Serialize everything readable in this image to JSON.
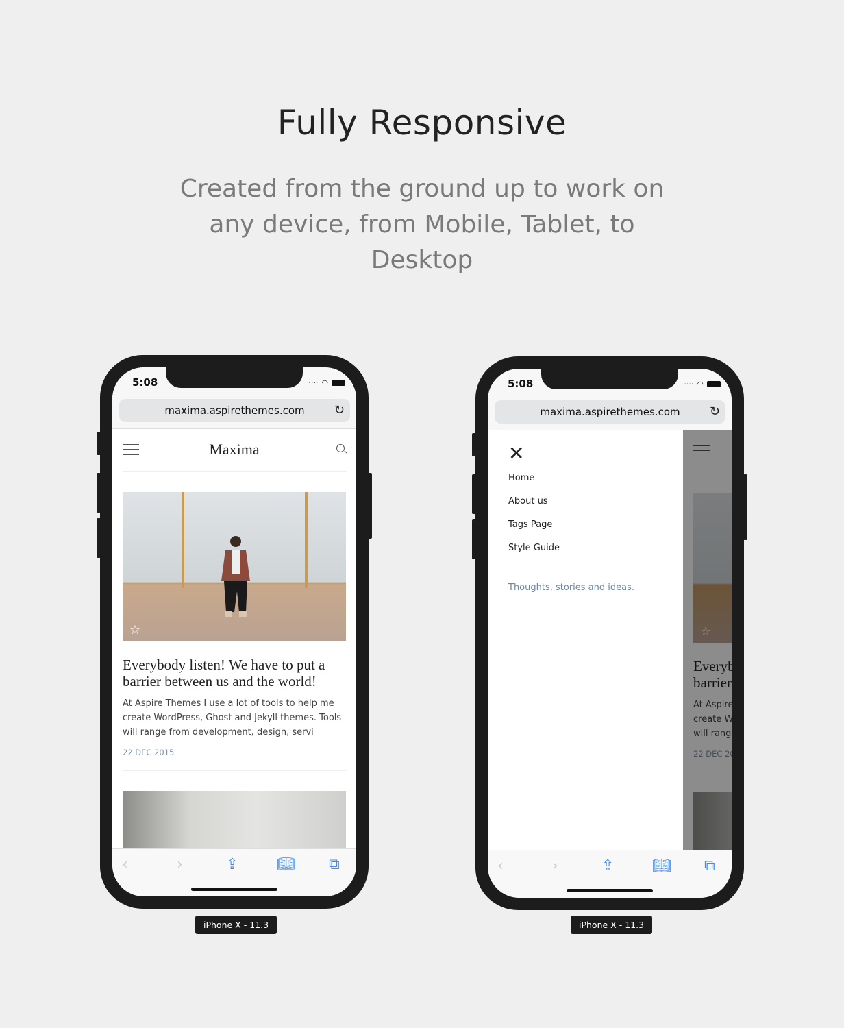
{
  "heading": "Fully Responsive",
  "subheading": "Created from the ground up to work on any device, from Mobile, Tablet, to Desktop",
  "phone": {
    "time": "5:08",
    "url": "maxima.aspirethemes.com",
    "device_label": "iPhone X - 11.3"
  },
  "blog": {
    "logo": "Maxima",
    "post_title": "Everybody listen! We have to put a barrier between us and the world!",
    "excerpt": "At Aspire Themes I use a lot of tools to help me create WordPress, Ghost and Jekyll themes. Tools will range from development, design, servi",
    "date": "22 DEC 2015"
  },
  "menu": {
    "items": [
      "Home",
      "About us",
      "Tags Page",
      "Style Guide"
    ],
    "tagline": "Thoughts, stories and ideas."
  },
  "colors": {
    "accent": "#3b8cf0",
    "date": "#7b8ea8",
    "frame": "#1c1c1c"
  }
}
